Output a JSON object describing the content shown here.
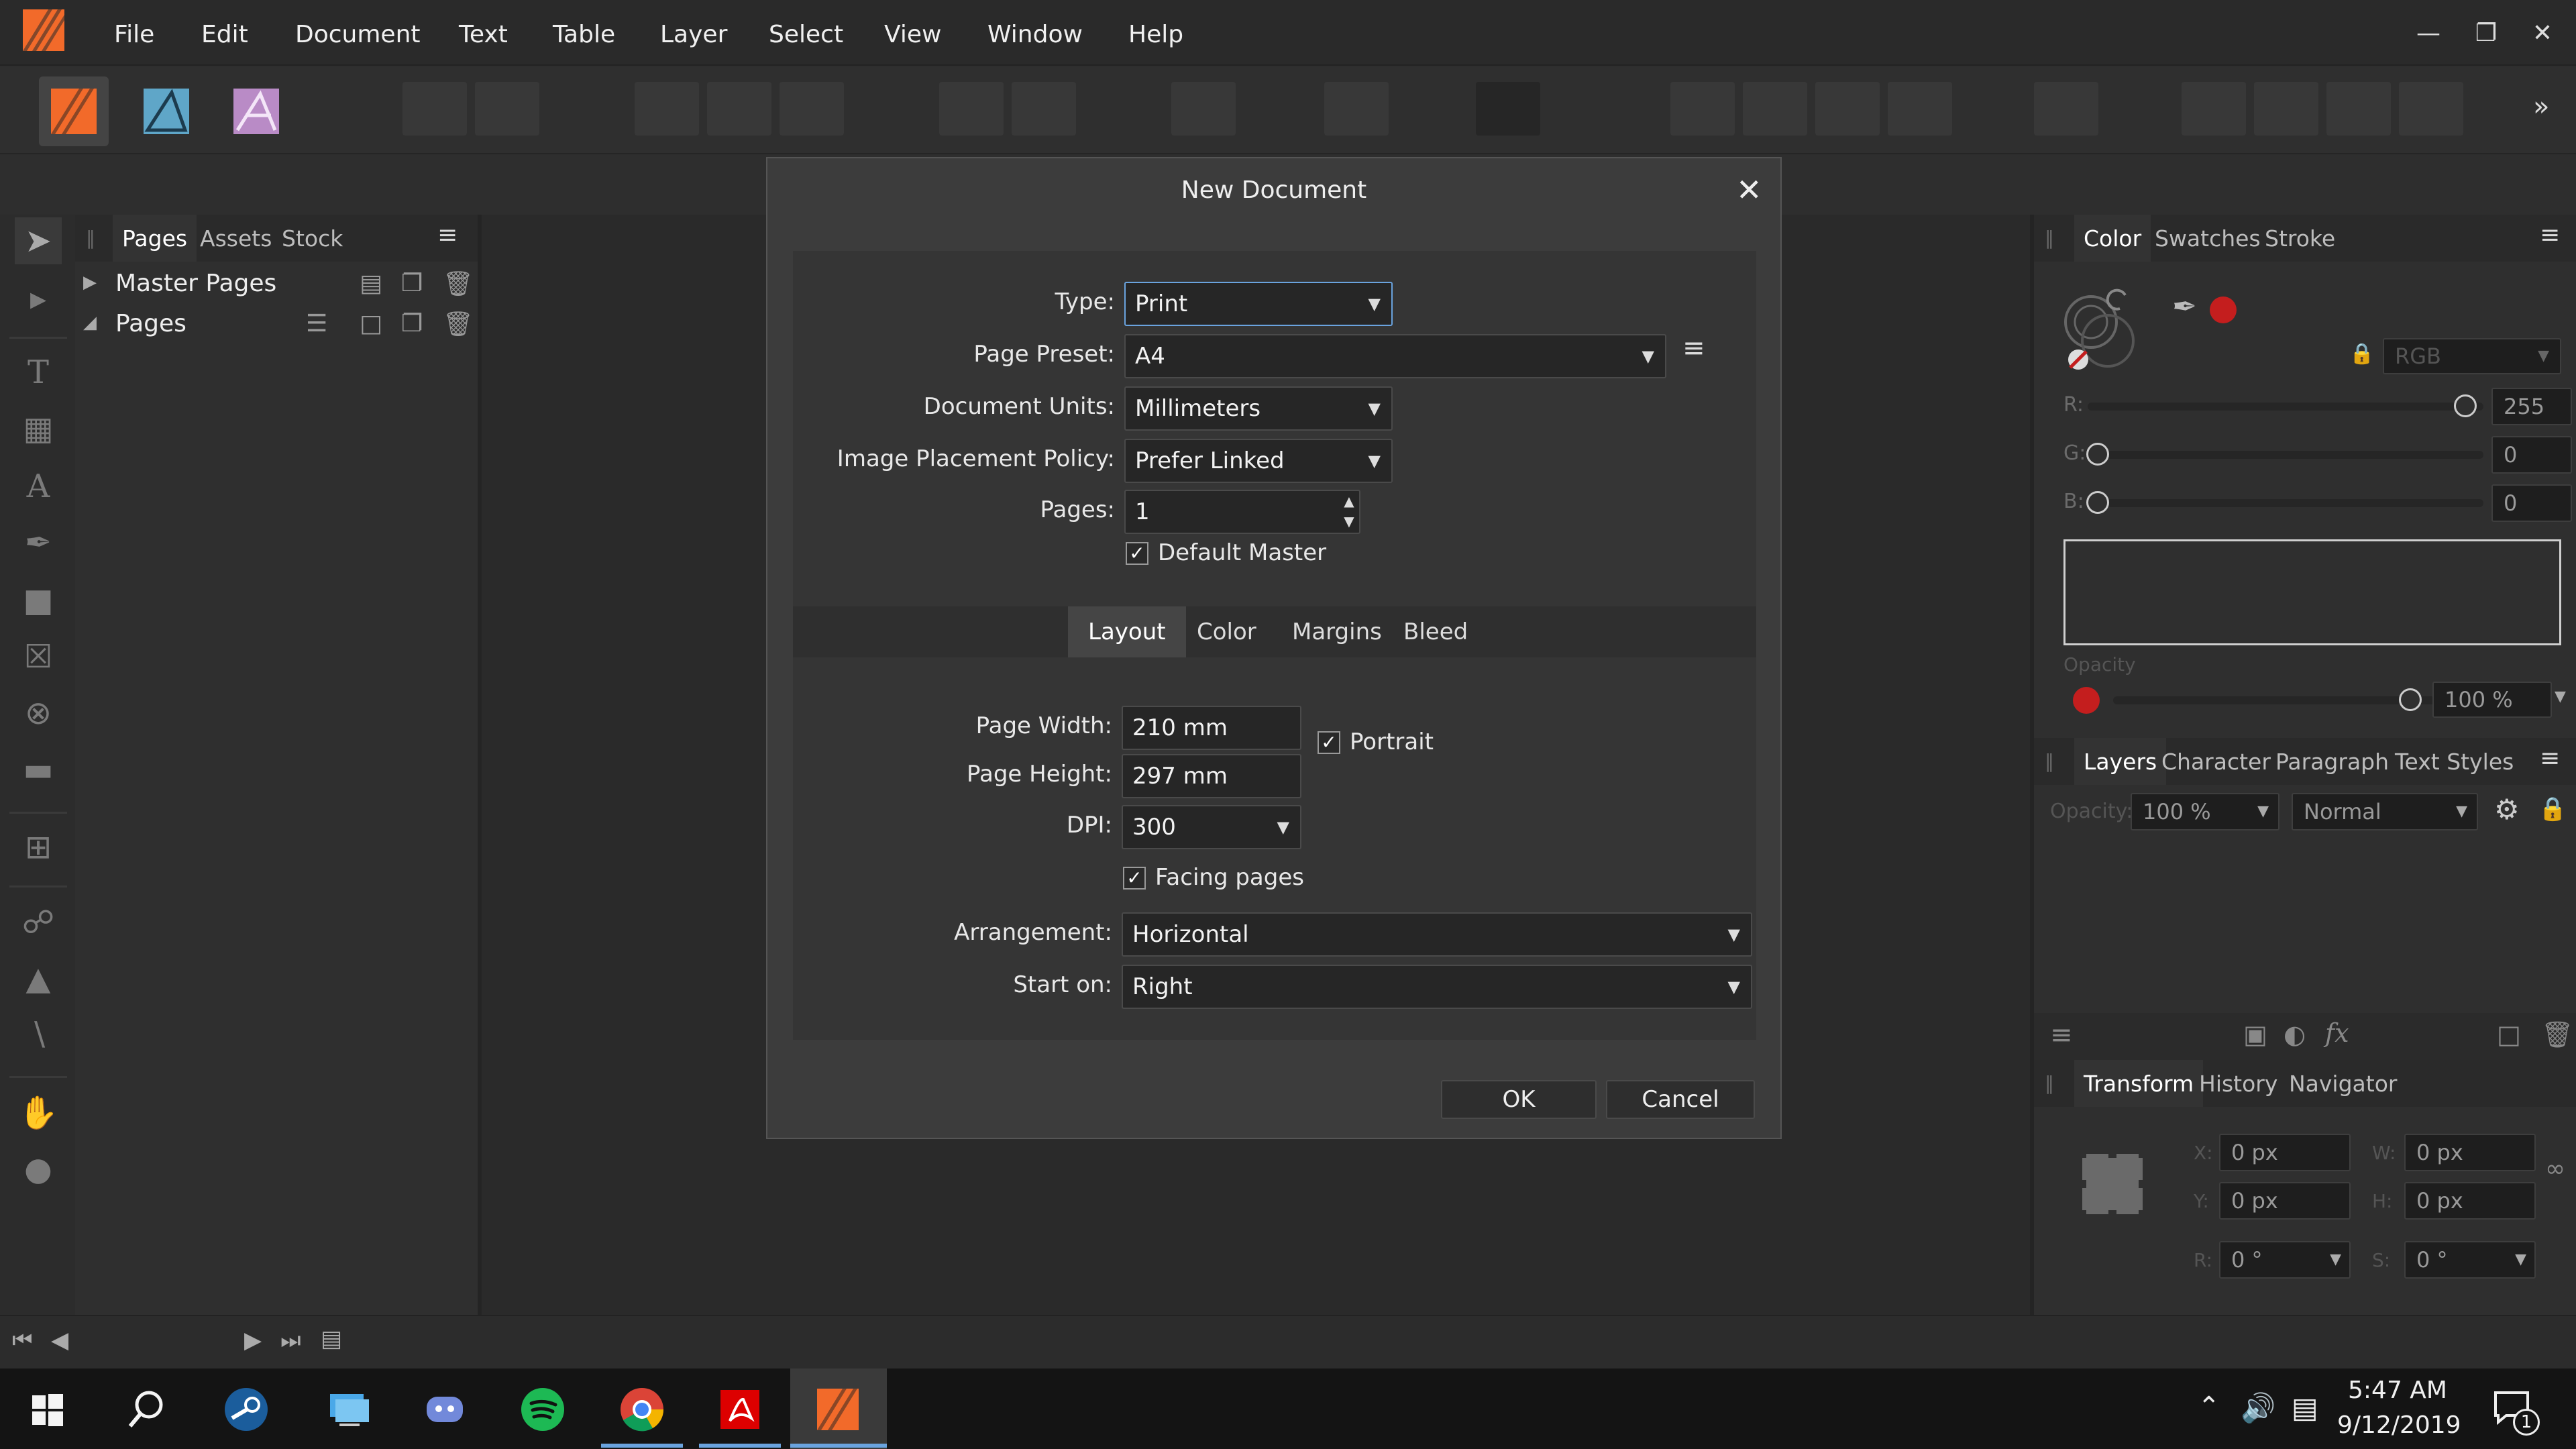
{
  "menu": [
    "File",
    "Edit",
    "Document",
    "Text",
    "Table",
    "Layer",
    "Select",
    "View",
    "Window",
    "Help"
  ],
  "left_panel": {
    "tabs": [
      "Pages",
      "Assets",
      "Stock"
    ],
    "rows": [
      "Master Pages",
      "Pages"
    ]
  },
  "color_panel": {
    "tabs": [
      "Color",
      "Swatches",
      "Stroke"
    ],
    "model": "RGB",
    "r_label": "R:",
    "g_label": "G:",
    "b_label": "B:",
    "r": "255",
    "g": "0",
    "b": "0",
    "opacity_label": "Opacity",
    "opacity": "100 %"
  },
  "layers_panel": {
    "tabs": [
      "Layers",
      "Character",
      "Paragraph",
      "Text Styles"
    ],
    "opacity_label": "Opacity:",
    "opacity": "100 %",
    "blend": "Normal"
  },
  "transform_panel": {
    "tabs": [
      "Transform",
      "History",
      "Navigator"
    ],
    "x_label": "X:",
    "y_label": "Y:",
    "w_label": "W:",
    "h_label": "H:",
    "r_label": "R:",
    "s_label": "S:",
    "x": "0 px",
    "y": "0 px",
    "w": "0 px",
    "h": "0 px",
    "r": "0 °",
    "s": "0 °"
  },
  "dialog": {
    "title": "New Document",
    "type_label": "Type:",
    "type": "Print",
    "preset_label": "Page Preset:",
    "preset": "A4",
    "units_label": "Document Units:",
    "units": "Millimeters",
    "image_policy_label": "Image Placement Policy:",
    "image_policy": "Prefer Linked",
    "pages_label": "Pages:",
    "pages": "1",
    "default_master": "Default Master",
    "tabs": [
      "Layout",
      "Color",
      "Margins",
      "Bleed"
    ],
    "width_label": "Page Width:",
    "width": "210 mm",
    "height_label": "Page Height:",
    "height": "297 mm",
    "dpi_label": "DPI:",
    "dpi": "300",
    "portrait": "Portrait",
    "facing_pages": "Facing pages",
    "arrangement_label": "Arrangement:",
    "arrangement": "Horizontal",
    "start_label": "Start on:",
    "start": "Right",
    "ok": "OK",
    "cancel": "Cancel"
  },
  "taskbar": {
    "time": "5:47 AM",
    "date": "9/12/2019",
    "notification_count": "1"
  },
  "colors": {
    "accent_red": "#c41e1e",
    "publisher_orange": "#f26a2a",
    "taskbar_active": "#6aa3de"
  }
}
